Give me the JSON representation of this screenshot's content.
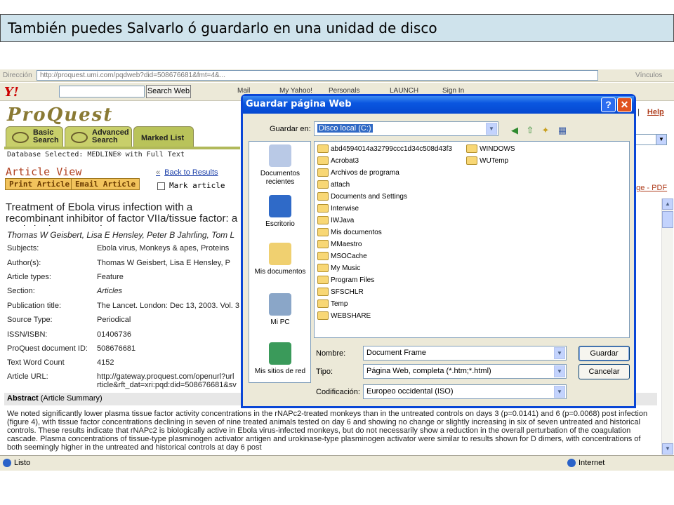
{
  "slide_title": "También puedes Salvarlo ó guardarlo  en una unidad de disco",
  "browser": {
    "address_label": "Dirección",
    "address_value": "http://proquest.umi.com/pqdweb?did=508676681&fmt=4&...",
    "links_label": "Vínculos",
    "search_web_label": "Search Web",
    "toolbar_items": [
      "Mail",
      "My Yahoo!",
      "Personals",
      "LAUNCH",
      "Sign In"
    ],
    "status_text": "Listo",
    "zone_text": "Internet"
  },
  "proquest": {
    "logo": "ProQuest",
    "tabs": [
      {
        "label": "Basic\nSearch"
      },
      {
        "label": "Advanced\nSearch"
      },
      {
        "label": "Marked List"
      }
    ],
    "database_selected": "Database Selected: MEDLINE® with Full Text",
    "article_view": "Article View",
    "back_to_results": "Back to Results",
    "print_article": "Print Article",
    "email_article": "Email Article",
    "mark_article": "Mark article",
    "help": "Help",
    "page_pdf": "age - PDF",
    "title": "Treatment of Ebola virus infection with a recombinant inhibitor of factor VIIa/tissue factor: a study in rhesus monkeys",
    "authors": "Thomas W Geisbert, Lisa E Hensley, Peter B Jahrling, Tom L",
    "meta": [
      {
        "k": "Subjects:",
        "v": "Ebola virus,  Monkeys & apes,  Proteins"
      },
      {
        "k": "Author(s):",
        "v": "Thomas W Geisbert,  Lisa E Hensley,  P"
      },
      {
        "k": "Article types:",
        "v": "Feature"
      },
      {
        "k": "Section:",
        "v": "Articles"
      },
      {
        "k": "Publication title:",
        "v": "The Lancet. London: Dec 13, 2003. Vol. 3"
      },
      {
        "k": "Source Type:",
        "v": "Periodical"
      },
      {
        "k": "ISSN/ISBN:",
        "v": "01406736"
      },
      {
        "k": "ProQuest document ID:",
        "v": "508676681"
      },
      {
        "k": "Text Word Count",
        "v": "4152"
      },
      {
        "k": "Article URL:",
        "v": "http://gateway.proquest.com/openurl?url\nrticle&rft_dat=xri:pqd:did=508676681&sv"
      }
    ],
    "abstract_label": "Abstract",
    "abstract_sub": "(Article Summary)",
    "abstract_text": "We noted significantly lower plasma tissue factor activity concentrations in the rNAPc2-treated monkeys than in the untreated controls on days 3 (p=0.0141) and 6 (p=0.0068) post infection (figure 4), with tissue factor concentrations declining in seven of nine treated animals tested on day 6 and showing no change or slightly increasing in six of seven untreated and historical controls. These results indicate that rNAPc2 is biologically active in Ebola virus-infected monkeys, but do not necessarily show a reduction in the overall perturbation of the coagulation cascade. Plasma concentrations of tissue-type plasminogen activator antigen and urokinase-type plasminogen activator were similar to results shown for D dimers, with concentrations of both seemingly higher in the untreated and historical controls at day 6 post"
  },
  "dialog": {
    "title": "Guardar página Web",
    "save_in_label": "Guardar en:",
    "save_in_value": "Disco local (C:)",
    "places": [
      "Documentos recientes",
      "Escritorio",
      "Mis documentos",
      "Mi PC",
      "Mis sitios de red"
    ],
    "folders_col1": [
      "abd4594014a32799ccc1d34c508d43f3",
      "Acrobat3",
      "Archivos de programa",
      "attach",
      "Documents and Settings",
      "Interwise",
      "IWJava",
      "Mis documentos",
      "MMaestro",
      "MSOCache",
      "My Music",
      "Program Files",
      "SFSCHLR",
      "Temp",
      "WEBSHARE"
    ],
    "folders_col2": [
      "WINDOWS",
      "WUTemp"
    ],
    "name_label": "Nombre:",
    "name_value": "Document Frame",
    "type_label": "Tipo:",
    "type_value": "Página Web, completa (*.htm;*.html)",
    "encoding_label": "Codificación:",
    "encoding_value": "Europeo occidental (ISO)",
    "save_button": "Guardar",
    "cancel_button": "Cancelar"
  }
}
